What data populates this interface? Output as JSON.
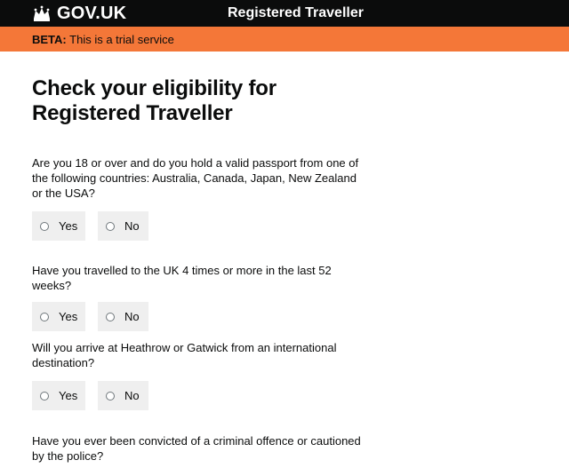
{
  "header": {
    "logo_text": "GOV.UK",
    "service_name": "Registered Traveller",
    "background": "#0b0c0c"
  },
  "phase_banner": {
    "tag": "BETA:",
    "text": "This is a trial service",
    "background": "#f47738"
  },
  "main": {
    "title": "Check your eligibility for Registered Traveller",
    "questions": [
      {
        "text": "Are you 18 or over and do you hold a valid passport from one of the following countries: Australia, Canada, Japan, New Zealand or the USA?",
        "options": [
          "Yes",
          "No"
        ]
      },
      {
        "text": "Have you travelled to the UK 4 times or more in the last 52 weeks?",
        "options": [
          "Yes",
          "No"
        ]
      },
      {
        "text": "Will you arrive at Heathrow or Gatwick from an international destination?",
        "options": [
          "Yes",
          "No"
        ]
      },
      {
        "text": "Have you ever been convicted of a criminal offence or cautioned by the police?",
        "options": []
      }
    ]
  },
  "icons": {
    "logo": "crown-icon",
    "radio": "radio-button-icon"
  }
}
